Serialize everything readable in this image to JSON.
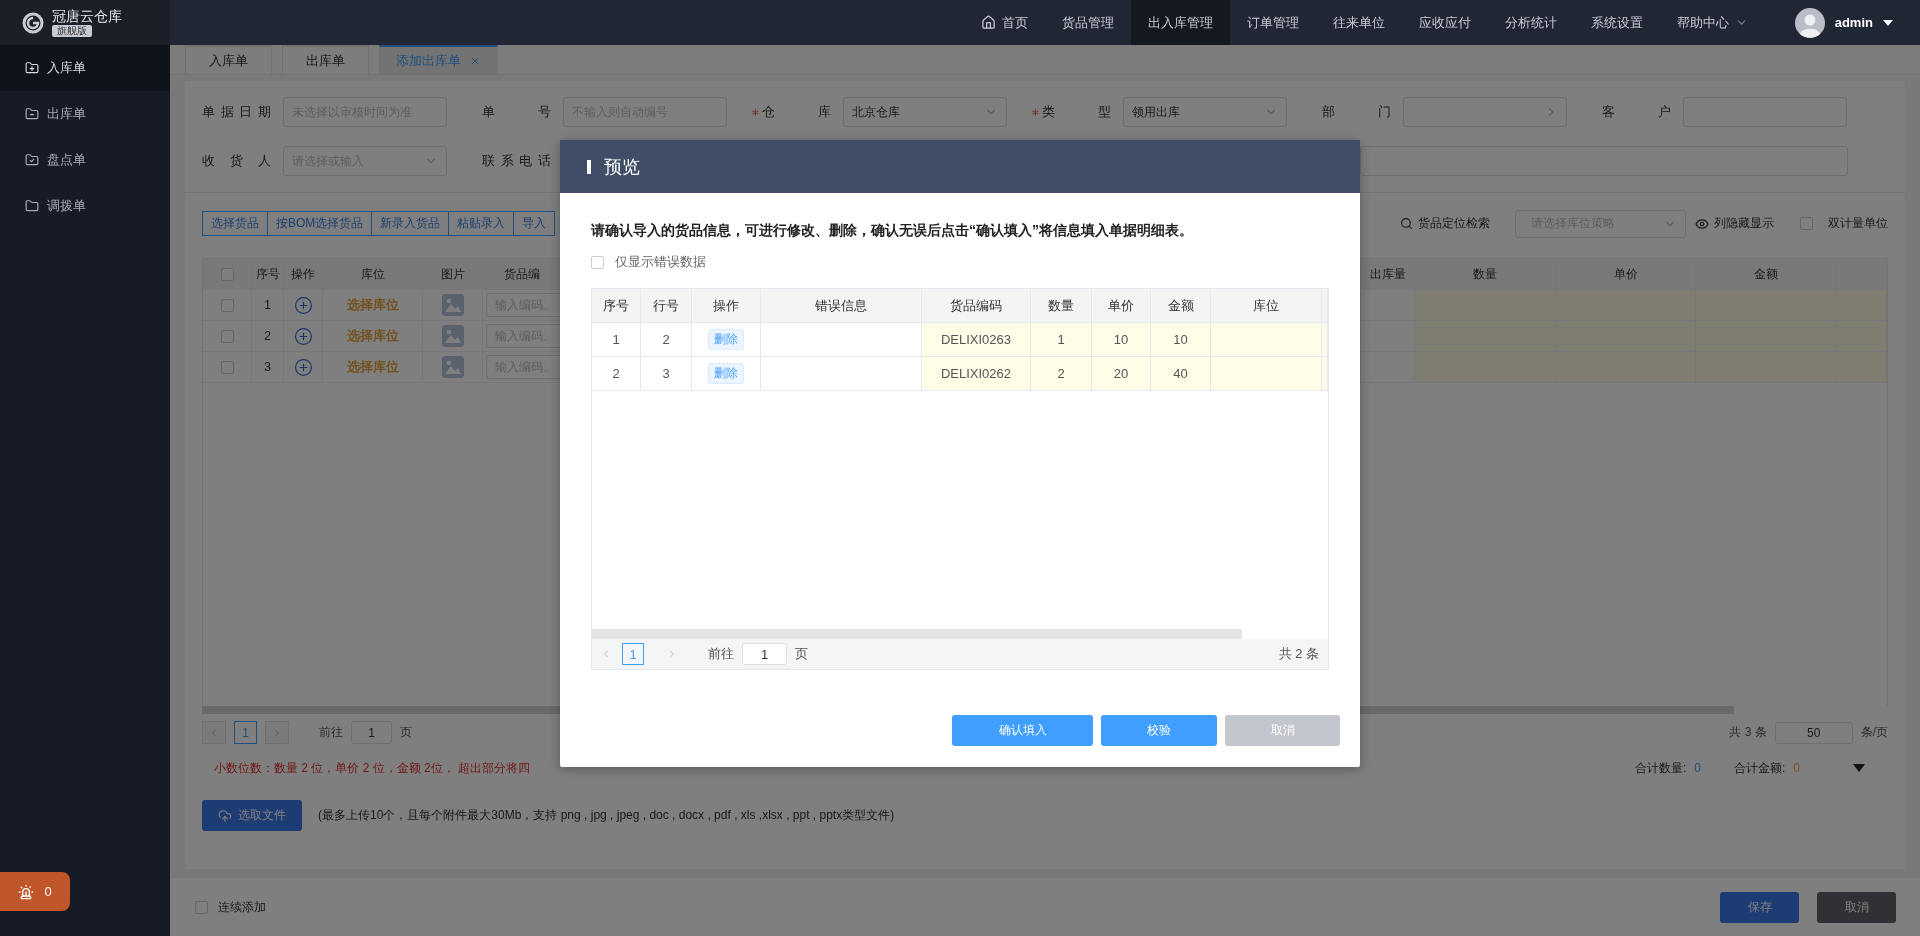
{
  "brand": {
    "name": "冠唐云仓库",
    "edition": "旗舰版"
  },
  "top_nav": {
    "items": [
      {
        "label": "首页",
        "kind": "home",
        "selected": false
      },
      {
        "label": "货品管理",
        "kind": "plain",
        "selected": false
      },
      {
        "label": "出入库管理",
        "kind": "plain",
        "selected": true
      },
      {
        "label": "订单管理",
        "kind": "plain",
        "selected": false
      },
      {
        "label": "往来单位",
        "kind": "plain",
        "selected": false
      },
      {
        "label": "应收应付",
        "kind": "plain",
        "selected": false
      },
      {
        "label": "分析统计",
        "kind": "plain",
        "selected": false
      },
      {
        "label": "系统设置",
        "kind": "plain",
        "selected": false
      },
      {
        "label": "帮助中心",
        "kind": "dropdown",
        "selected": false
      }
    ],
    "user": {
      "name": "admin"
    }
  },
  "sidebar": {
    "items": [
      {
        "label": "入库单",
        "kind": "add",
        "selected": true
      },
      {
        "label": "出库单",
        "kind": "remove",
        "selected": false
      },
      {
        "label": "盘点单",
        "kind": "check",
        "selected": false
      },
      {
        "label": "调拨单",
        "kind": "plain",
        "selected": false
      }
    ],
    "alarm_count": "0"
  },
  "tabs": [
    {
      "label": "入库单",
      "selected": false,
      "closable": false
    },
    {
      "label": "出库单",
      "selected": false,
      "closable": false
    },
    {
      "label": "添加出库单",
      "selected": true,
      "closable": true
    }
  ],
  "form": {
    "rows": [
      [
        {
          "label": "单据日期",
          "required": false,
          "kind": "input",
          "placeholder": "未选择以审核时间为准"
        },
        {
          "label": "单号",
          "required": false,
          "kind": "input",
          "placeholder": "不输入则自动编号"
        },
        {
          "label": "仓库",
          "required": true,
          "kind": "select",
          "value": "北京仓库"
        },
        {
          "label": "类型",
          "required": true,
          "kind": "select",
          "value": "领用出库"
        },
        {
          "label": "部门",
          "required": false,
          "kind": "cascader"
        },
        {
          "label": "客户",
          "required": false,
          "kind": "input"
        }
      ],
      [
        {
          "label": "收货人",
          "required": false,
          "kind": "select",
          "placeholder": "请选择或输入"
        },
        {
          "label": "联系电话",
          "required": false,
          "kind": "label"
        },
        {
          "kind": "input",
          "wide": true
        }
      ]
    ]
  },
  "toolbar": {
    "buttons": [
      "选择货品",
      "按BOM选择货品",
      "新录入货品",
      "粘贴录入",
      "导入"
    ],
    "locate": "货品定位检索",
    "strategy_placeholder": "请选择库位策略",
    "column_toggle": "列隐藏显示",
    "dual_unit": {
      "label": "双计量单位",
      "checked": false
    }
  },
  "items_table": {
    "select_all_checked": false,
    "columns": [
      "序号",
      "操作",
      "库位",
      "图片",
      "货品编",
      "出库量",
      "数量",
      "单价",
      "金额"
    ],
    "rows": [
      {
        "no": "1",
        "checked": false,
        "location": "选择库位",
        "code_placeholder": "输入编码、"
      },
      {
        "no": "2",
        "checked": false,
        "location": "选择库位",
        "code_placeholder": "输入编码、"
      },
      {
        "no": "3",
        "checked": false,
        "location": "选择库位",
        "code_placeholder": "输入编码、"
      }
    ]
  },
  "items_pagination": {
    "pages": [
      {
        "label": "1",
        "selected": true
      }
    ],
    "goto_label": "前往",
    "goto_value": "1",
    "page_suffix": "页",
    "total": "共 3 条",
    "page_size": "50",
    "per_page": "条/页"
  },
  "notice": "小数位数：数量 2 位，单价 2 位，金额 2位， 超出部分将四",
  "totals": [
    {
      "label": "合计数量:",
      "value": "0",
      "kind": "quantity"
    },
    {
      "label": "合计金额:",
      "value": "0",
      "kind": "amount"
    }
  ],
  "upload": {
    "button": "选取文件",
    "hint": "(最多上传10个，且每个附件最大30Mb，支持 png , jpg , jpeg , doc , docx , pdf , xls ,xlsx , ppt , pptx类型文件)"
  },
  "footer": {
    "continue_add": {
      "label": "连续添加",
      "checked": false
    },
    "buttons": [
      {
        "label": "保存",
        "kind": "primary"
      },
      {
        "label": "取消",
        "kind": "disabled"
      }
    ]
  },
  "modal": {
    "title": "预览",
    "instruction": "请确认导入的货品信息，可进行修改、删除，确认无误后点击“确认填入”将信息填入单据明细表。",
    "errors_only": {
      "label": "仅显示错误数据",
      "checked": false
    },
    "table": {
      "columns": [
        "序号",
        "行号",
        "操作",
        "错误信息",
        "货品编码",
        "数量",
        "单价",
        "金额",
        "库位"
      ],
      "rows": [
        {
          "seq": "1",
          "line": "2",
          "action": "删除",
          "code": "DELIXI0263",
          "qty": "1",
          "price": "10",
          "amount": "10"
        },
        {
          "seq": "2",
          "line": "3",
          "action": "删除",
          "code": "DELIXI0262",
          "qty": "2",
          "price": "20",
          "amount": "40"
        }
      ]
    },
    "pagination": {
      "pages": [
        {
          "label": "1",
          "selected": true
        }
      ],
      "goto_label": "前往",
      "goto_value": "1",
      "page_suffix": "页",
      "total": "共 2 条"
    },
    "buttons": [
      {
        "label": "确认填入",
        "kind": "primary"
      },
      {
        "label": "校验",
        "kind": "primary"
      },
      {
        "label": "取消",
        "kind": "muted"
      }
    ]
  }
}
